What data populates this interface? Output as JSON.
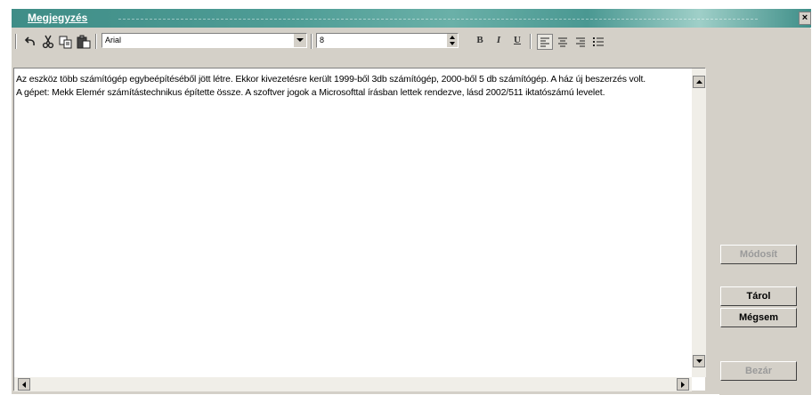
{
  "window": {
    "title": "Megjegyzés",
    "close_label": "×"
  },
  "toolbar": {
    "font_name": "Arial",
    "font_size": "8",
    "bold_label": "B",
    "italic_label": "I",
    "underline_label": "U"
  },
  "editor": {
    "paragraphs": [
      "Az eszköz több számítógép egybeépítéséből jött létre. Ekkor kivezetésre került 1999-ből 3db számítógép, 2000-ből 5 db számítógép. A ház új beszerzés volt.",
      "A gépet: Mekk Elemér számítástechnikus építette össze. A szoftver jogok a Microsofttal írásban lettek rendezve, lásd 2002/511 iktatószámú levelet."
    ]
  },
  "side_buttons": {
    "modify": "Módosít",
    "store": "Tárol",
    "cancel": "Mégsem",
    "close": "Bezár"
  },
  "icons": {
    "undo": "undo-icon",
    "cut": "cut-icon",
    "copy": "copy-icon",
    "paste": "paste-icon",
    "align_left": "align-left-icon",
    "align_center": "align-center-icon",
    "align_right": "align-right-icon",
    "bullets": "bullet-list-icon"
  },
  "colors": {
    "titlebar": "#4f9d96",
    "face": "#d4d0c8"
  }
}
